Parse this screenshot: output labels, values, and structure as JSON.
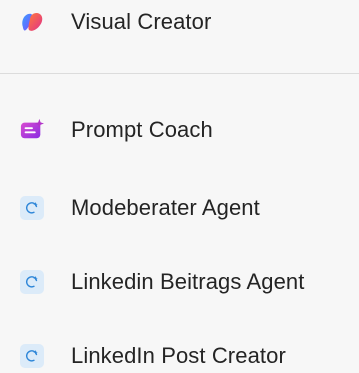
{
  "menu": {
    "items": [
      {
        "label": "Visual Creator",
        "icon": "visual-creator-icon"
      },
      {
        "label": "Prompt Coach",
        "icon": "prompt-coach-icon"
      },
      {
        "label": "Modeberater Agent",
        "icon": "agent-icon"
      },
      {
        "label": "Linkedin Beitrags Agent",
        "icon": "agent-icon"
      },
      {
        "label": "LinkedIn Post Creator",
        "icon": "agent-icon"
      }
    ]
  },
  "colors": {
    "background": "#f7f7f7",
    "divider": "#dcdcdc",
    "text": "#242424",
    "agent_icon_bg": "#dcebf9",
    "agent_icon_stroke": "#2e86d8",
    "prompt_coach_pink": "#c239c6",
    "visual_creator_orange": "#f07a3a"
  }
}
